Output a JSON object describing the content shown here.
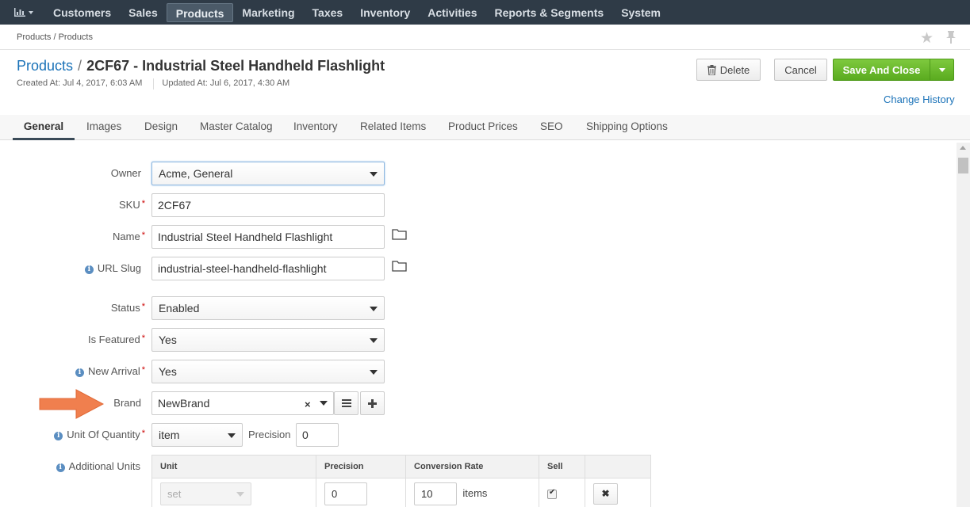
{
  "topnav": {
    "items": [
      {
        "label": "Customers"
      },
      {
        "label": "Sales"
      },
      {
        "label": "Products"
      },
      {
        "label": "Marketing"
      },
      {
        "label": "Taxes"
      },
      {
        "label": "Inventory"
      },
      {
        "label": "Activities"
      },
      {
        "label": "Reports & Segments"
      },
      {
        "label": "System"
      }
    ],
    "active": "Products",
    "dashboard_icon": "bar-chart-icon"
  },
  "breadcrumb": "Products / Products",
  "header": {
    "entity_link": "Products",
    "separator": "/",
    "title": "2CF67 - Industrial Steel Handheld Flashlight",
    "created": "Created At: Jul 4, 2017, 6:03 AM",
    "updated": "Updated At: Jul 6, 2017, 4:30 AM"
  },
  "actions": {
    "delete": "Delete",
    "cancel": "Cancel",
    "save": "Save And Close",
    "change_history": "Change History"
  },
  "tabs": [
    "General",
    "Images",
    "Design",
    "Master Catalog",
    "Inventory",
    "Related Items",
    "Product Prices",
    "SEO",
    "Shipping Options"
  ],
  "active_tab": "General",
  "form": {
    "owner": {
      "label": "Owner",
      "value": "Acme, General"
    },
    "sku": {
      "label": "SKU",
      "value": "2CF67"
    },
    "name": {
      "label": "Name",
      "value": "Industrial Steel Handheld Flashlight"
    },
    "url_slug": {
      "label": "URL Slug",
      "value": "industrial-steel-handheld-flashlight"
    },
    "status": {
      "label": "Status",
      "value": "Enabled"
    },
    "is_featured": {
      "label": "Is Featured",
      "value": "Yes"
    },
    "new_arrival": {
      "label": "New Arrival",
      "value": "Yes"
    },
    "brand": {
      "label": "Brand",
      "value": "NewBrand",
      "clear": "×"
    },
    "unit_of_quantity": {
      "label": "Unit Of Quantity",
      "value": "item",
      "precision_label": "Precision",
      "precision_value": "0"
    },
    "additional_units": {
      "label": "Additional Units",
      "columns": [
        "Unit",
        "Precision",
        "Conversion Rate",
        "Sell"
      ],
      "rows": [
        {
          "unit": "set",
          "precision": "0",
          "conversion_rate": "10",
          "rate_unit": "items",
          "sell": true,
          "remove": "✖"
        }
      ]
    }
  },
  "colors": {
    "navbar": "#2f3b47",
    "link": "#1a72b8",
    "save_button": "#6cbb2e",
    "annotation_arrow": "#f07f4e"
  }
}
